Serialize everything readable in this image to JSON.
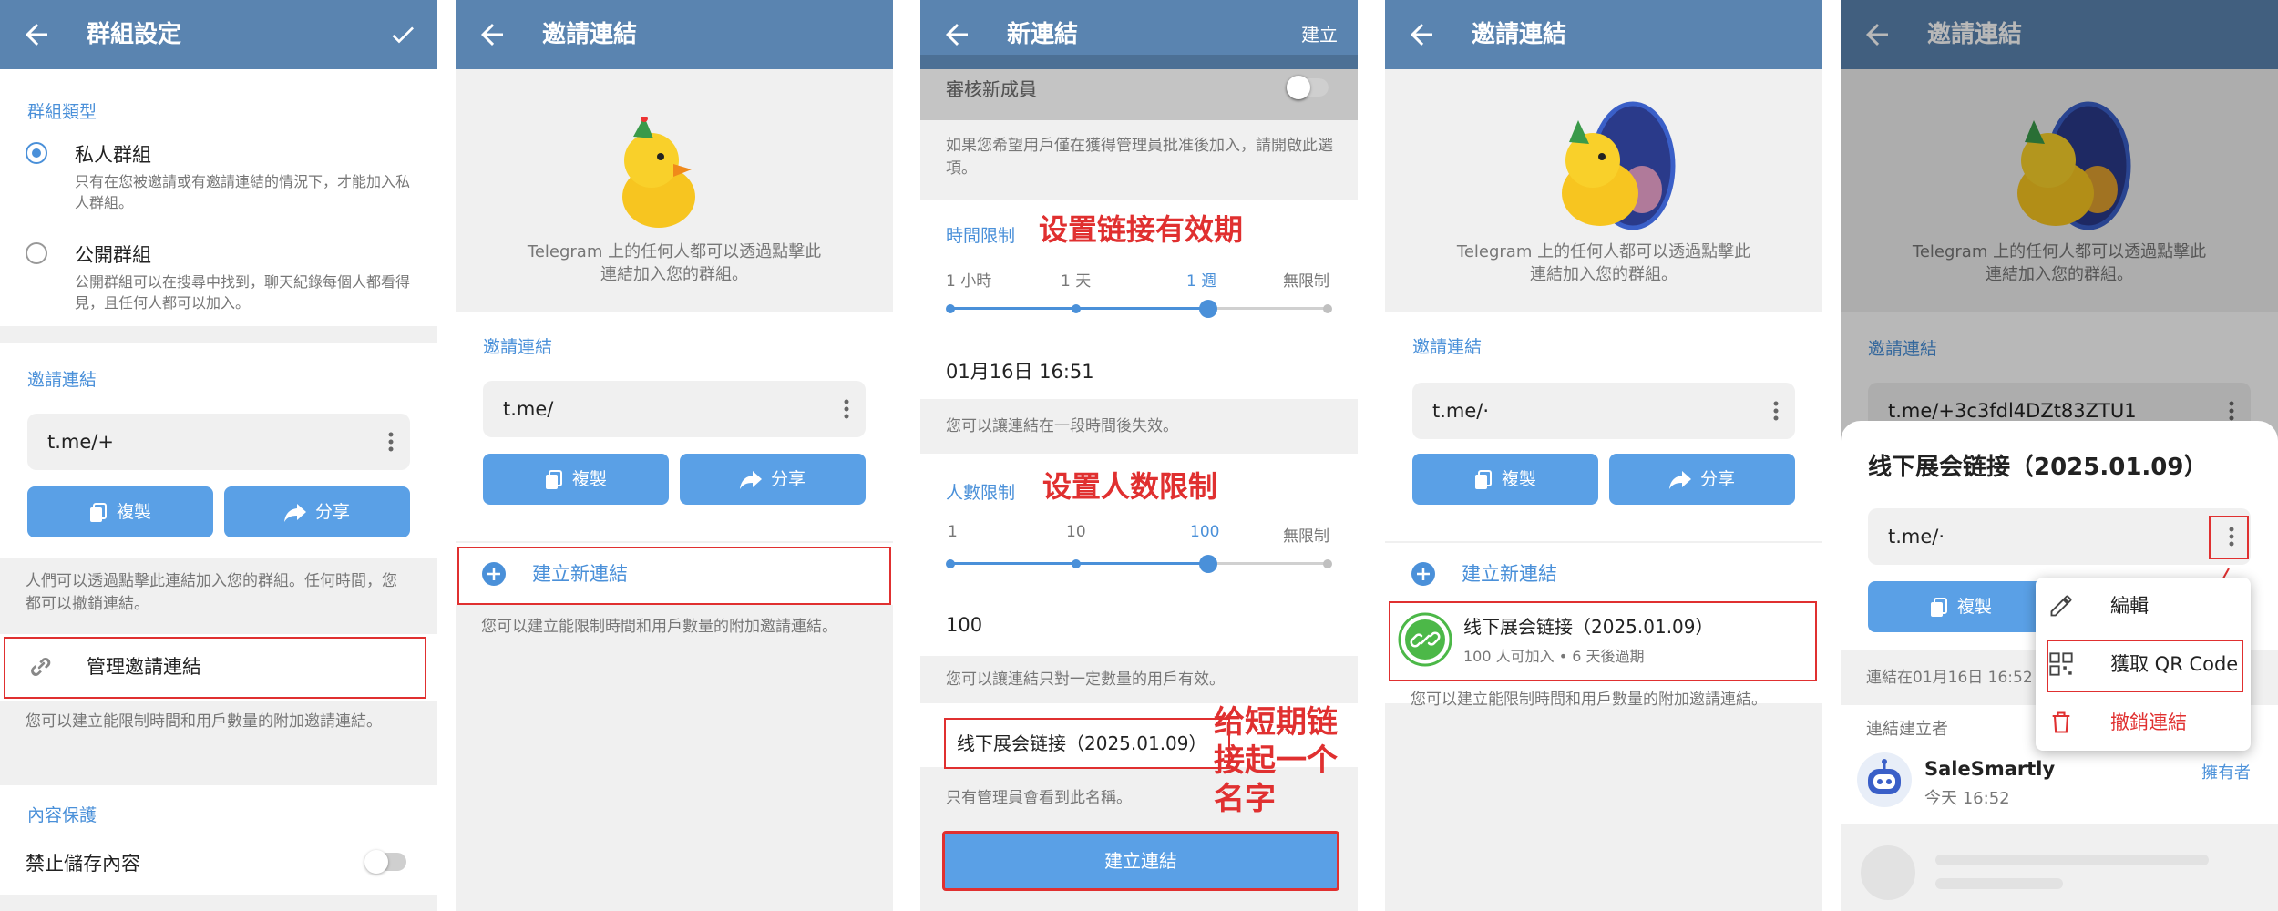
{
  "p1": {
    "title": "群組設定",
    "group_type_label": "群組類型",
    "private_title": "私人群組",
    "private_desc": "只有在您被邀請或有邀請連結的情況下，才能加入私人群組。",
    "public_title": "公開群組",
    "public_desc": "公開群組可以在搜尋中找到，聊天紀錄每個人都看得見，且任何人都可以加入。",
    "invite_label": "邀請連結",
    "link_value": "t.me/+",
    "copy_label": "複製",
    "share_label": "分享",
    "invite_note": "人們可以透過點擊此連結加入您的群組。任何時間，您都可以撤銷連結。",
    "manage_label": "管理邀請連結",
    "manage_note": "您可以建立能限制時間和用戶數量的附加邀請連結。",
    "content_label": "內容保護",
    "restrict_label": "禁止儲存內容"
  },
  "p2": {
    "title": "邀請連結",
    "desc": "Telegram 上的任何人都可以透過點擊此連結加入您的群組。",
    "invite_label": "邀請連結",
    "link_value": "t.me/",
    "copy_label": "複製",
    "share_label": "分享",
    "create_label": "建立新連結",
    "create_note": "您可以建立能限制時間和用戶數量的附加邀請連結。"
  },
  "p3": {
    "title": "新連結",
    "create_action": "建立",
    "approve_label": "審核新成員",
    "approve_note": "如果您希望用戶僅在獲得管理員批准後加入，請開啟此選項。",
    "time_label": "時間限制",
    "time_annotation": "设置链接有效期",
    "time_ticks": [
      "1 小時",
      "1 天",
      "1 週",
      "無限制"
    ],
    "time_value": "01月16日 16:51",
    "time_note": "您可以讓連結在一段時間後失效。",
    "count_label": "人數限制",
    "count_annotation": "设置人数限制",
    "count_ticks": [
      "1",
      "10",
      "100",
      "無限制"
    ],
    "count_value": "100",
    "count_note": "您可以讓連結只對一定數量的用戶有效。",
    "name_value": "线下展会链接（2025.01.09）",
    "name_annotation": "给短期链接起一个名字",
    "name_note": "只有管理員會看到此名稱。",
    "submit_label": "建立連結"
  },
  "p4": {
    "title": "邀請連結",
    "desc": "Telegram 上的任何人都可以透過點擊此連結加入您的群組。",
    "invite_label": "邀請連結",
    "link_value": "t.me/·",
    "copy_label": "複製",
    "share_label": "分享",
    "create_label": "建立新連結",
    "item_title": "线下展会链接（2025.01.09）",
    "item_sub": "100 人可加入 • 6 天後過期",
    "note": "您可以建立能限制時間和用戶數量的附加邀請連結。"
  },
  "p5": {
    "title": "邀請連結",
    "desc": "Telegram 上的任何人都可以透過點擊此連結加入您的群組。",
    "invite_label": "邀請連結",
    "bg_link": "t.me/+3c3fdl4DZt83ZTU1",
    "sheet_title": "线下展会链接（2025.01.09）",
    "sheet_link": "t.me/·",
    "copy_label": "複製",
    "expire_label": "連結在01月16日 16:52",
    "creator_label": "連結建立者",
    "creator_name": "SaleSmartly",
    "creator_role": "擁有者",
    "creator_time": "今天 16:52",
    "menu": {
      "edit": "編輯",
      "qr": "獲取 QR Code",
      "revoke": "撤銷連結"
    }
  },
  "colors": {
    "header": "#5a84b0",
    "accent": "#4a90d9",
    "button": "#5aa0e6",
    "annotation": "#e03030"
  }
}
